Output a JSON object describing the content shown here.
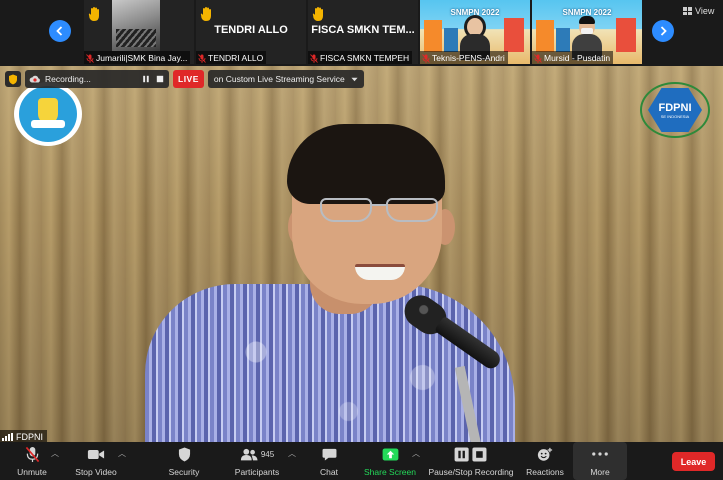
{
  "gallery": {
    "view_label": "View",
    "tiles": [
      {
        "name": "Jumarili|SMK Bina Jay...",
        "raised_hand": true,
        "muted": true
      },
      {
        "name": "TENDRI ALLO",
        "display_name": "TENDRI ALLO",
        "raised_hand": true,
        "muted": true
      },
      {
        "name": "FISCA SMKN TEMPEH",
        "display_name": "FISCA SMKN TEM...",
        "raised_hand": true,
        "muted": true
      },
      {
        "name": "Teknis-PENS-Andri",
        "banner": "SNMPN 2022",
        "muted": true
      },
      {
        "name": "Mursid - Pusdatin",
        "banner": "SNMPN 2022",
        "muted": true
      }
    ]
  },
  "recording": {
    "status": "Recording...",
    "live_label": "LIVE",
    "live_target": "on Custom Live Streaming Service"
  },
  "main_video": {
    "speaker_name": "FDPNI",
    "right_logo_text": "FDPNI",
    "right_logo_sub": "SE INDONESIA"
  },
  "toolbar": {
    "unmute": "Unmute",
    "stop_video": "Stop Video",
    "security": "Security",
    "participants": "Participants",
    "participant_count": "945",
    "chat": "Chat",
    "share_screen": "Share Screen",
    "pause_stop_recording": "Pause/Stop Recording",
    "reactions": "Reactions",
    "more": "More",
    "leave": "Leave"
  },
  "colors": {
    "accent_blue": "#2d8cff",
    "live_red": "#e02828",
    "share_green": "#23d959",
    "toolbar_bg": "#1a1a1a"
  }
}
